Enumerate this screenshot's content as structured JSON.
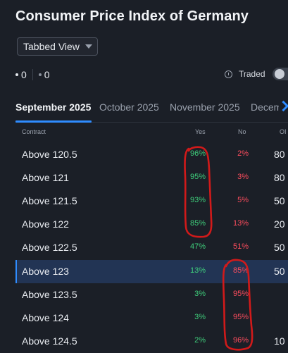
{
  "page": {
    "title": "Consumer Price Index of Germany"
  },
  "view_select": {
    "value": "Tabbed View",
    "icon": "chevron-down-icon"
  },
  "stats": [
    {
      "value": "0"
    },
    {
      "value": "0"
    }
  ],
  "traded": {
    "label": "Traded",
    "icon": "info-icon",
    "enabled": false
  },
  "tabs": [
    {
      "label": "September 2025",
      "active": true
    },
    {
      "label": "October 2025",
      "active": false
    },
    {
      "label": "November 2025",
      "active": false
    },
    {
      "label": "Decem",
      "active": false
    }
  ],
  "table": {
    "columns": {
      "contract": "Contract",
      "yes": "Yes",
      "no": "No",
      "oi": "OI"
    },
    "rows": [
      {
        "contract": "Above 120.5",
        "yes": "96%",
        "no": "2%",
        "oi": "80",
        "selected": false
      },
      {
        "contract": "Above 121",
        "yes": "95%",
        "no": "3%",
        "oi": "80",
        "selected": false
      },
      {
        "contract": "Above 121.5",
        "yes": "93%",
        "no": "5%",
        "oi": "50",
        "selected": false
      },
      {
        "contract": "Above 122",
        "yes": "85%",
        "no": "13%",
        "oi": "20",
        "selected": false
      },
      {
        "contract": "Above 122.5",
        "yes": "47%",
        "no": "51%",
        "oi": "50",
        "selected": false
      },
      {
        "contract": "Above 123",
        "yes": "13%",
        "no": "85%",
        "oi": "50",
        "selected": true
      },
      {
        "contract": "Above 123.5",
        "yes": "3%",
        "no": "95%",
        "oi": "",
        "selected": false
      },
      {
        "contract": "Above 124",
        "yes": "3%",
        "no": "95%",
        "oi": "",
        "selected": false
      },
      {
        "contract": "Above 124.5",
        "yes": "2%",
        "no": "96%",
        "oi": "10",
        "selected": false
      }
    ]
  },
  "colors": {
    "background": "#1b1f27",
    "accent": "#2f8cff",
    "yes": "#3fcf7c",
    "no": "#ff4d5e",
    "selected_row": "#223454",
    "annotation": "#d11a1a"
  }
}
